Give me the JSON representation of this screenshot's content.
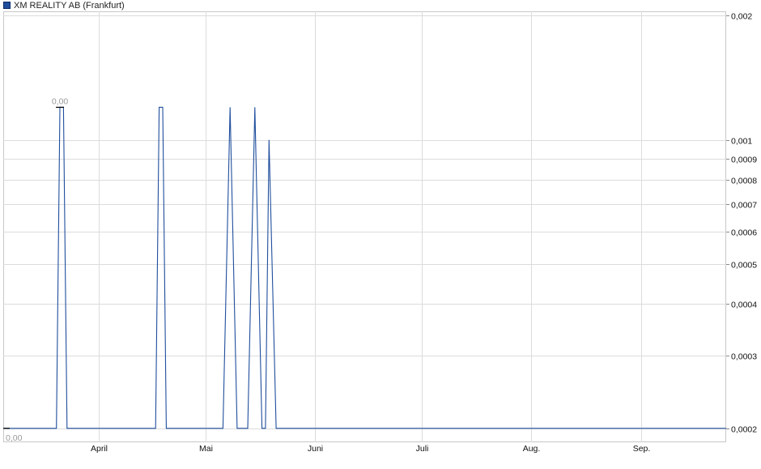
{
  "legend": {
    "series_name": "XM REALITY AB (Frankfurt)",
    "color": "#1f4e9c"
  },
  "chart_data": {
    "type": "line",
    "title": "",
    "xlabel": "",
    "ylabel": "",
    "y_scale": "log",
    "ylim": [
      0.000185,
      0.00205
    ],
    "x_range": [
      "2023-03-05",
      "2023-09-25"
    ],
    "x_ticks": [
      {
        "date": "2023-04-01",
        "label": "April"
      },
      {
        "date": "2023-05-01",
        "label": "Mai"
      },
      {
        "date": "2023-06-01",
        "label": "Juni"
      },
      {
        "date": "2023-07-01",
        "label": "Juli"
      },
      {
        "date": "2023-08-01",
        "label": "Aug."
      },
      {
        "date": "2023-09-01",
        "label": "Sep."
      }
    ],
    "y_ticks": [
      {
        "value": 0.002,
        "label": "0,002"
      },
      {
        "value": 0.001,
        "label": "0,001"
      },
      {
        "value": 0.0009,
        "label": "0,0009"
      },
      {
        "value": 0.0008,
        "label": "0,0008"
      },
      {
        "value": 0.0007,
        "label": "0,0007"
      },
      {
        "value": 0.0006,
        "label": "0,0006"
      },
      {
        "value": 0.0005,
        "label": "0,0005"
      },
      {
        "value": 0.0004,
        "label": "0,0004"
      },
      {
        "value": 0.0003,
        "label": "0,0003"
      },
      {
        "value": 0.0002,
        "label": "0,0002"
      }
    ],
    "grid": true,
    "series": [
      {
        "name": "XM REALITY AB (Frankfurt)",
        "color": "#1f4e9c",
        "points": [
          [
            "2023-03-05",
            0.0002
          ],
          [
            "2023-03-20",
            0.0002
          ],
          [
            "2023-03-21",
            0.0012
          ],
          [
            "2023-03-22",
            0.0012
          ],
          [
            "2023-03-23",
            0.0002
          ],
          [
            "2023-04-17",
            0.0002
          ],
          [
            "2023-04-18",
            0.0012
          ],
          [
            "2023-04-19",
            0.0012
          ],
          [
            "2023-04-20",
            0.0002
          ],
          [
            "2023-05-06",
            0.0002
          ],
          [
            "2023-05-08",
            0.0012
          ],
          [
            "2023-05-10",
            0.0002
          ],
          [
            "2023-05-13",
            0.0002
          ],
          [
            "2023-05-15",
            0.0012
          ],
          [
            "2023-05-17",
            0.0002
          ],
          [
            "2023-05-18",
            0.0002
          ],
          [
            "2023-05-19",
            0.001
          ],
          [
            "2023-05-21",
            0.0002
          ],
          [
            "2023-09-25",
            0.0002
          ]
        ]
      }
    ],
    "annotations": [
      {
        "kind": "max",
        "date": "2023-03-21",
        "value": 0.0012,
        "label": "0,00"
      },
      {
        "kind": "min",
        "date": "2023-03-05",
        "value": 0.0002,
        "label": "0,00"
      }
    ]
  }
}
